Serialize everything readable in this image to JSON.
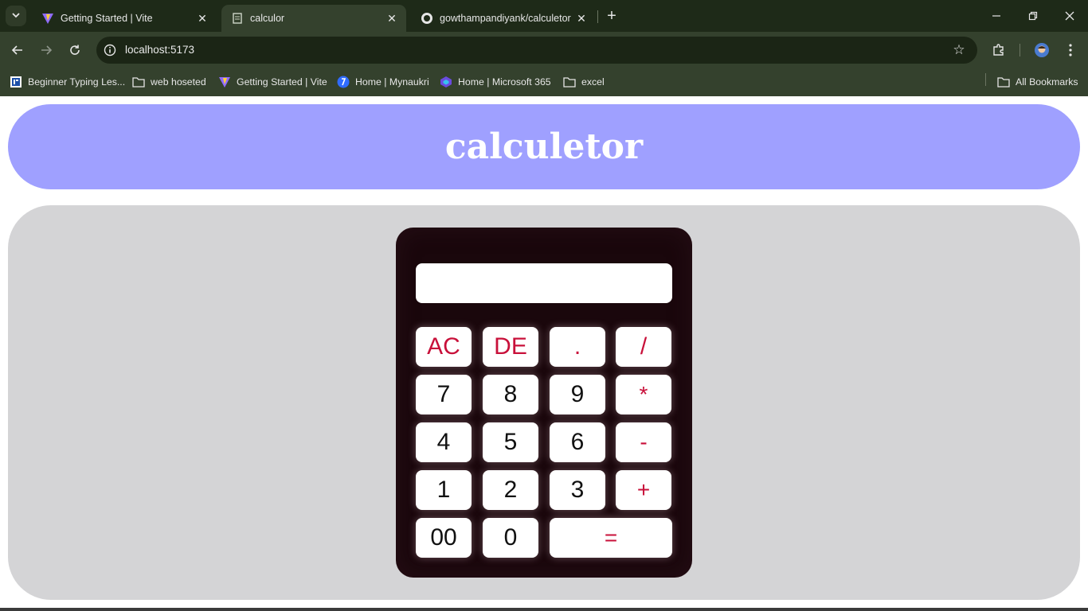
{
  "browser": {
    "tabs": [
      {
        "title": "Getting Started | Vite",
        "favicon": "vite-icon",
        "active": false
      },
      {
        "title": "calculor",
        "favicon": "document-icon",
        "active": true
      },
      {
        "title": "gowthampandiyank/calculetor",
        "favicon": "github-icon",
        "active": false
      }
    ],
    "url": "localhost:5173",
    "bookmarks": [
      {
        "label": "Beginner Typing Les...",
        "icon": "typing-icon"
      },
      {
        "label": "web hoseted",
        "icon": "folder-icon"
      },
      {
        "label": "Getting Started | Vite",
        "icon": "vite-icon"
      },
      {
        "label": "Home | Mynaukri",
        "icon": "mynaukri-icon"
      },
      {
        "label": "Home | Microsoft 365",
        "icon": "microsoft365-icon"
      },
      {
        "label": "excel",
        "icon": "folder-icon"
      }
    ],
    "all_bookmarks": "All Bookmarks"
  },
  "page": {
    "title": "calculetor"
  },
  "calculator": {
    "display_value": "",
    "keys": {
      "ac": "AC",
      "de": "DE",
      "dot": ".",
      "divide": "/",
      "seven": "7",
      "eight": "8",
      "nine": "9",
      "multiply": "*",
      "four": "4",
      "five": "5",
      "six": "6",
      "minus": "-",
      "one": "1",
      "two": "2",
      "three": "3",
      "plus": "+",
      "double_zero": "00",
      "zero": "0",
      "equals": "="
    }
  },
  "colors": {
    "header_bg": "#9fa0ff",
    "stage_bg": "#d4d4d6",
    "calc_body": "#1a070c",
    "operator_text": "#c8103a"
  }
}
